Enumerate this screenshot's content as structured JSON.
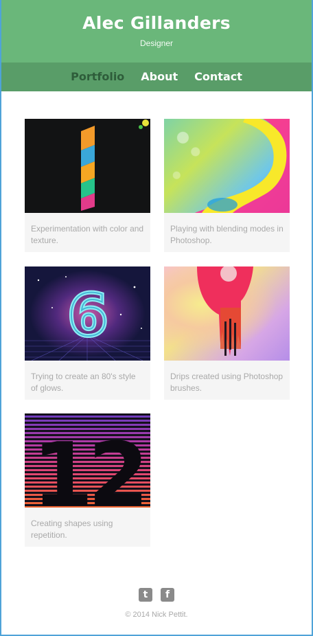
{
  "header": {
    "title": "Alec Gillanders",
    "subtitle": "Designer"
  },
  "nav": {
    "items": [
      {
        "label": "Portfolio",
        "active": true
      },
      {
        "label": "About",
        "active": false
      },
      {
        "label": "Contact",
        "active": false
      }
    ]
  },
  "gallery": {
    "items": [
      {
        "caption": "Experimentation with color and texture.",
        "thumb": "numeral-1-art"
      },
      {
        "caption": "Playing with blending modes in Photoshop.",
        "thumb": "numeral-2-art"
      },
      {
        "caption": "Trying to create an 80's style of glows.",
        "thumb": "numeral-6-art"
      },
      {
        "caption": "Drips created using Photoshop brushes.",
        "thumb": "numeral-9-art"
      },
      {
        "caption": "Creating shapes using repetition.",
        "thumb": "numeral-12-art"
      }
    ]
  },
  "footer": {
    "social": [
      {
        "icon": "twitter-icon",
        "glyph": "t"
      },
      {
        "icon": "facebook-icon",
        "glyph": "f"
      }
    ],
    "copyright": "© 2014 Nick Pettit."
  },
  "colors": {
    "header_bg": "#6ab77a",
    "nav_bg": "#599d68",
    "nav_active": "#2e5d3a",
    "caption_text": "#a9a9a9",
    "card_bg": "#f5f5f5"
  }
}
